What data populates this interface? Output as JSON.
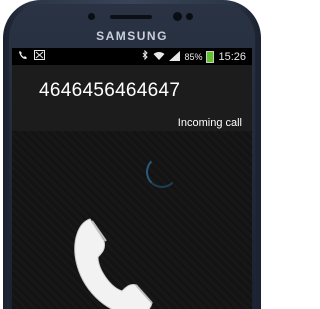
{
  "device": {
    "brand": "SAMSUNG"
  },
  "status_bar": {
    "left_icons": [
      "phone-call-icon",
      "missed-call-icon"
    ],
    "right_icons": [
      "bluetooth-icon",
      "wifi-icon",
      "signal-icon"
    ],
    "battery_percent": "85%",
    "time": "15:26"
  },
  "call": {
    "number": "4646456464647",
    "status": "Incoming call"
  },
  "colors": {
    "battery": "#5fc22a",
    "screen_bg": "#101010",
    "header_bg": "#1c1c1c",
    "spinner": "#2a5a78"
  }
}
